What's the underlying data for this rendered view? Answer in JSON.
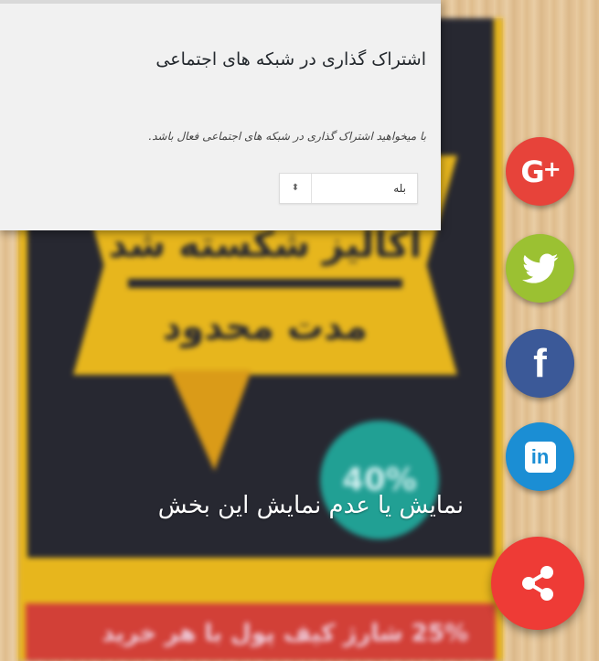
{
  "settings_panel": {
    "title": "اشتراک گذاری در شبکه های اجتماعی",
    "description": "با میخواهید اشتراک گذاری در شبکه های اجتماعی فعال باشد.",
    "select": {
      "selected": "بله"
    }
  },
  "poster": {
    "headline_1": "اکالیز شکسته شد",
    "headline_2": "مدت محدود",
    "discount": "40%",
    "bottom_banner": "25% شارژ کیف پول با هر خرید"
  },
  "social_buttons": [
    {
      "name": "google-plus",
      "glyph": "G+",
      "color": "#e7433a"
    },
    {
      "name": "twitter",
      "glyph": "twitter-bird",
      "color": "#9bc132"
    },
    {
      "name": "facebook",
      "glyph": "f",
      "color": "#3b5998"
    },
    {
      "name": "linkedin",
      "glyph": "in",
      "color": "#1b8ed4"
    }
  ],
  "share_button": {
    "icon": "share-icon",
    "color": "#ee3b36"
  },
  "overlay_label": "نمایش یا عدم نمایش این بخش"
}
